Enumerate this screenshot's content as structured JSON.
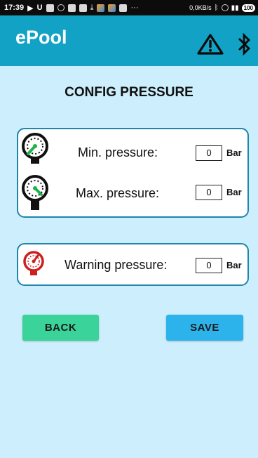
{
  "status_bar": {
    "time": "17:39",
    "speed": "0,0KB/s",
    "ellipsis": "···",
    "battery": "100"
  },
  "app": {
    "title": "ePool"
  },
  "page": {
    "title": "CONFIG PRESSURE"
  },
  "pressure_card": {
    "min_label": "Min. pressure:",
    "min_value": "0",
    "max_label": "Max. pressure:",
    "max_value": "0",
    "unit": "Bar"
  },
  "warning_card": {
    "label": "Warning pressure:",
    "value": "0",
    "unit": "Bar"
  },
  "buttons": {
    "back": "BACK",
    "save": "SAVE"
  },
  "colors": {
    "app_bar": "#11a2c6",
    "background": "#cdeefc",
    "card_border": "#1f85aa",
    "back_button": "#3ad39a",
    "save_button": "#2db3ec",
    "gauge_needle_green": "#1fb34a",
    "warning_gauge": "#cc1f1f"
  },
  "icons": {
    "warning": "warning-triangle-icon",
    "bluetooth": "bluetooth-icon",
    "min_gauge": "pressure-gauge-icon",
    "max_gauge": "pressure-gauge-icon",
    "warning_gauge": "warning-gauge-icon"
  }
}
